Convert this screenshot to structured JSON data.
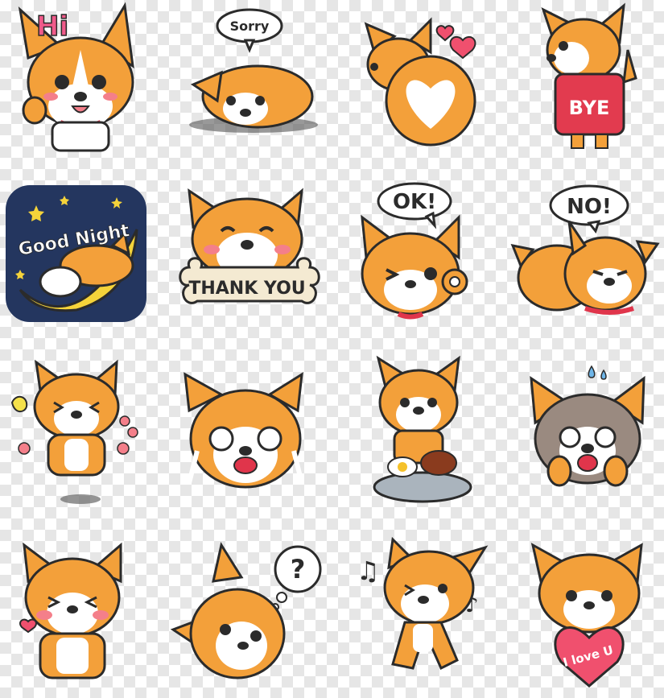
{
  "colors": {
    "fur": "#f3a03a",
    "fur_dark": "#e08a25",
    "white": "#ffffff",
    "outline": "#2b2b2b",
    "blush": "#f47f8a",
    "collar": "#e0354b",
    "sweater": "#e23b4f",
    "night_sky": "#24365f",
    "moon": "#f5d33a",
    "bone": "#f4ead2",
    "heart": "#f0506e"
  },
  "stickers": [
    {
      "name": "hi",
      "text": "Hi"
    },
    {
      "name": "sorry",
      "text": "Sorry"
    },
    {
      "name": "hearts-butt",
      "text": ""
    },
    {
      "name": "bye",
      "text": "BYE"
    },
    {
      "name": "good-night",
      "text": "Good Night"
    },
    {
      "name": "thank-you",
      "text": "THANK YOU"
    },
    {
      "name": "ok",
      "text": "OK!"
    },
    {
      "name": "no",
      "text": "NO!"
    },
    {
      "name": "happy-jump",
      "text": ""
    },
    {
      "name": "crying",
      "text": ""
    },
    {
      "name": "eating",
      "text": ""
    },
    {
      "name": "shocked",
      "text": ""
    },
    {
      "name": "laughing",
      "text": ""
    },
    {
      "name": "question",
      "text": "?"
    },
    {
      "name": "dancing",
      "text": ""
    },
    {
      "name": "i-love-u",
      "text": "I love U"
    }
  ]
}
